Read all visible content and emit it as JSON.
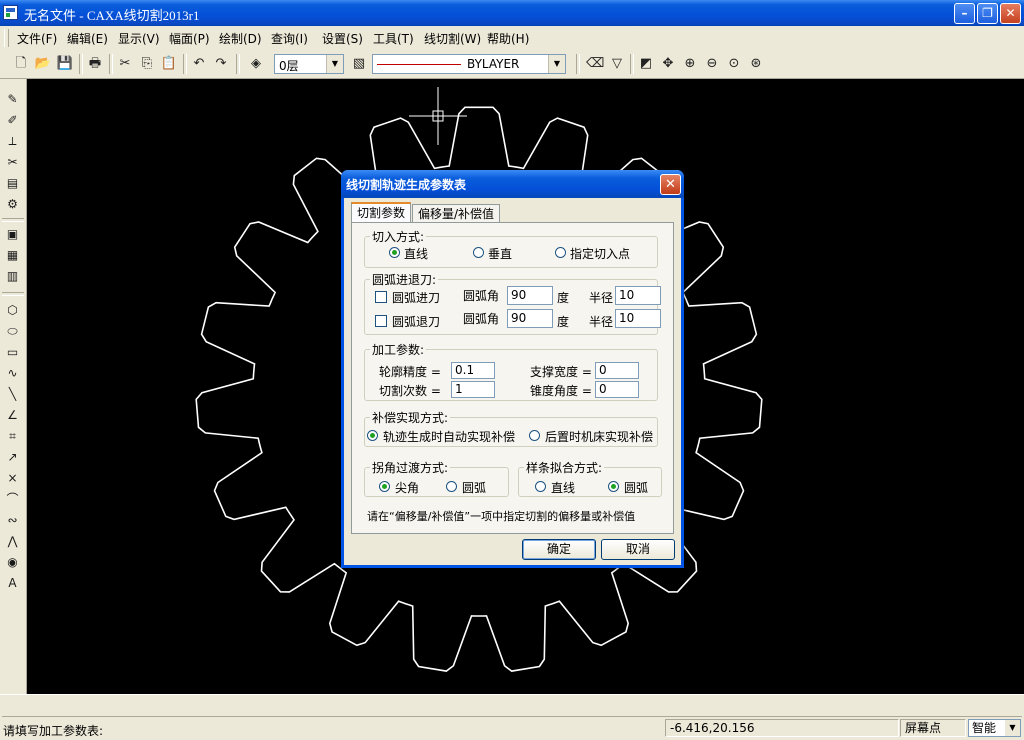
{
  "window": {
    "title": "无名文件 - CAXA线切割2013r1"
  },
  "menu": [
    "文件(F)",
    "编辑(E)",
    "显示(V)",
    "幅面(P)",
    "绘制(D)",
    "查询(I)",
    "设置(S)",
    "工具(T)",
    "线切割(W)",
    "帮助(H)"
  ],
  "toolbar": {
    "layer": "0层",
    "linetype": "BYLAYER"
  },
  "status": {
    "prompt": "请填写加工参数表:",
    "coords": "-6.416,20.156",
    "screen_point": "屏幕点",
    "snap_mode": "智能"
  },
  "colors": {
    "canvas": "#000000",
    "gear": "#ffffff",
    "title_bar": "#0a5ddb"
  },
  "dialog": {
    "title": "线切割轨迹生成参数表",
    "tabs": [
      "切割参数",
      "偏移量/补偿值"
    ],
    "entry": {
      "title": "切入方式:",
      "options": [
        "直线",
        "垂直",
        "指定切入点"
      ],
      "selected": 0
    },
    "arc": {
      "title": "圆弧进退刀:",
      "in": {
        "label": "圆弧进刀",
        "checked": false,
        "angle_label": "圆弧角",
        "angle": "90",
        "deg": "度",
        "radius_label": "半径",
        "radius": "10"
      },
      "out": {
        "label": "圆弧退刀",
        "checked": false,
        "angle_label": "圆弧角",
        "angle": "90",
        "deg": "度",
        "radius_label": "半径",
        "radius": "10"
      }
    },
    "process": {
      "title": "加工参数:",
      "precision_label": "轮廓精度 =",
      "precision": "0.1",
      "passes_label": "切割次数 =",
      "passes": "1",
      "support_label": "支撑宽度 =",
      "support": "0",
      "taper_label": "锥度角度 =",
      "taper": "0"
    },
    "comp": {
      "title": "补偿实现方式:",
      "options": [
        "轨迹生成时自动实现补偿",
        "后置时机床实现补偿"
      ],
      "selected": 0
    },
    "corner": {
      "title": "拐角过渡方式:",
      "options": [
        "尖角",
        "圆弧"
      ],
      "selected": 0
    },
    "spline": {
      "title": "样条拟合方式:",
      "options": [
        "直线",
        "圆弧"
      ],
      "selected": 1
    },
    "note": "请在“偏移量/补偿值”一项中指定切割的偏移量或补偿值",
    "ok": "确定",
    "cancel": "取消"
  }
}
